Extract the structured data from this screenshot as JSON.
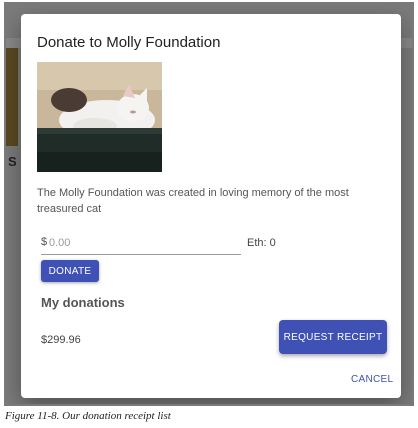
{
  "dialog": {
    "title": "Donate to Molly Foundation",
    "description": "The Molly Foundation was created in loving memory of the most treasured cat",
    "currency_symbol": "$",
    "amount_placeholder": "0.00",
    "eth_label": "Eth: 0",
    "donate_label": "DONATE",
    "my_donations_heading": "My donations",
    "donations": [
      {
        "amount": "$299.96",
        "action_label": "REQUEST RECEIPT"
      }
    ],
    "cancel_label": "CANCEL"
  },
  "caption": "Figure 11-8. Our donation receipt list",
  "colors": {
    "primary": "#3f51b5",
    "backdrop": "#7b7b7b",
    "text": "#555555"
  },
  "icons": {
    "photo": "cat-photo"
  }
}
